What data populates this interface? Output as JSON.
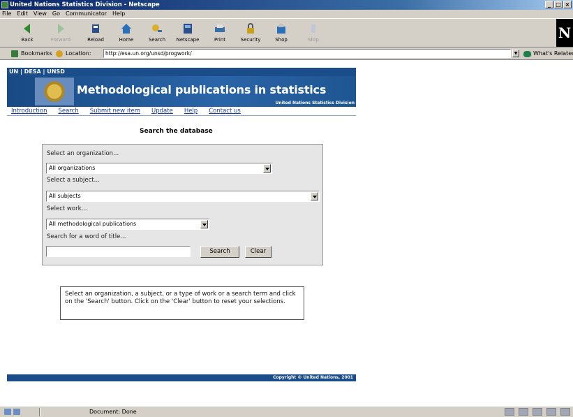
{
  "window": {
    "title": "United Nations Statistics Division - Netscape"
  },
  "menu": [
    "File",
    "Edit",
    "View",
    "Go",
    "Communicator",
    "Help"
  ],
  "toolbar": {
    "buttons": [
      {
        "label": "Back",
        "icon": "back-arrow-icon",
        "enabled": true
      },
      {
        "label": "Forward",
        "icon": "forward-arrow-icon",
        "enabled": false
      },
      {
        "label": "Reload",
        "icon": "reload-icon",
        "enabled": true
      },
      {
        "label": "Home",
        "icon": "home-icon",
        "enabled": true
      },
      {
        "label": "Search",
        "icon": "search-icon",
        "enabled": true
      },
      {
        "label": "Netscape",
        "icon": "netscape-icon",
        "enabled": true
      },
      {
        "label": "Print",
        "icon": "print-icon",
        "enabled": true
      },
      {
        "label": "Security",
        "icon": "lock-icon",
        "enabled": true
      },
      {
        "label": "Shop",
        "icon": "shop-icon",
        "enabled": true
      },
      {
        "label": "Stop",
        "icon": "stop-icon",
        "enabled": false
      }
    ]
  },
  "location": {
    "bookmarks_label": "Bookmarks",
    "location_label": "Location:",
    "url": "http://esa.un.org/unsd/progwork/",
    "related_label": "What's Related"
  },
  "page": {
    "top_links": "UN | DESA | UNSD",
    "banner_title": "Methodological publications in statistics",
    "banner_subtitle": "United Nations Statistics Division",
    "nav": [
      "Introduction",
      "Search",
      "Submit new item",
      "Update",
      "Help",
      "Contact us"
    ],
    "search_title": "Search the database",
    "form": {
      "org_label": "Select an organization...",
      "org_value": "All organizations",
      "subject_label": "Select a subject...",
      "subject_value": "All subjects",
      "work_label": "Select work...",
      "work_value": "All methodological publications",
      "word_label": "Search for a word of title...",
      "word_value": "",
      "search_button": "Search",
      "clear_button": "Clear"
    },
    "help_text": "Select an organization, a subject, or a type of work or a search term and click on the 'Search' button. Click on the 'Clear' button to reset your selections.",
    "footer": "Copyright © United Nations, 2001"
  },
  "status": {
    "text": "Document: Done"
  }
}
